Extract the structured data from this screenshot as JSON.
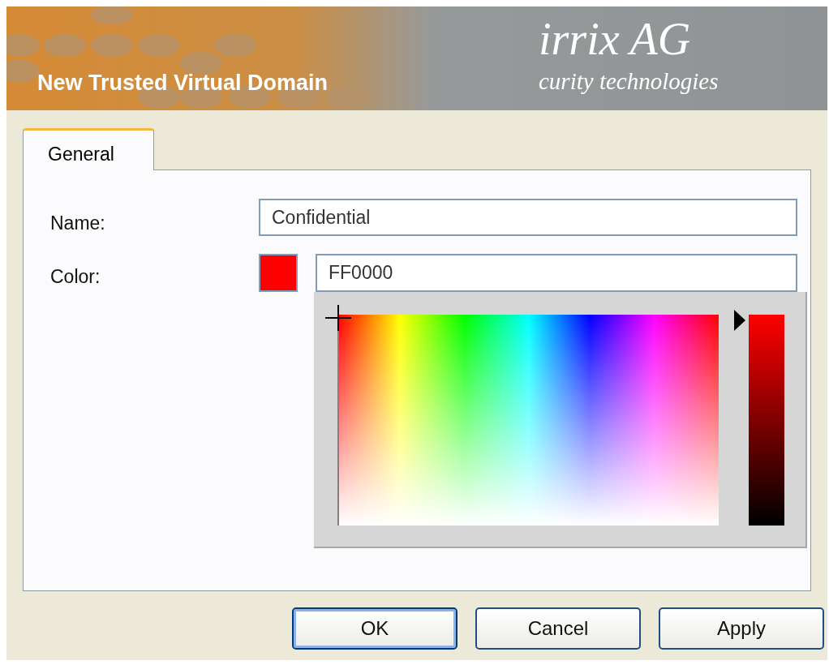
{
  "banner": {
    "title": "New Trusted Virtual Domain",
    "logo_name": "irrix AG",
    "logo_tagline": "curity technologies"
  },
  "tabs": [
    {
      "label": "General",
      "selected": true
    }
  ],
  "form": {
    "name_label": "Name:",
    "name_value": "Confidential",
    "color_label": "Color:",
    "color_swatch": {
      "color": "#ff0000"
    },
    "color_value": "FF0000"
  },
  "color_picker": {
    "open": true
  },
  "buttons": [
    {
      "label": "OK",
      "default": true
    },
    {
      "label": "Cancel",
      "default": false
    },
    {
      "label": "Apply",
      "default": false
    }
  ]
}
